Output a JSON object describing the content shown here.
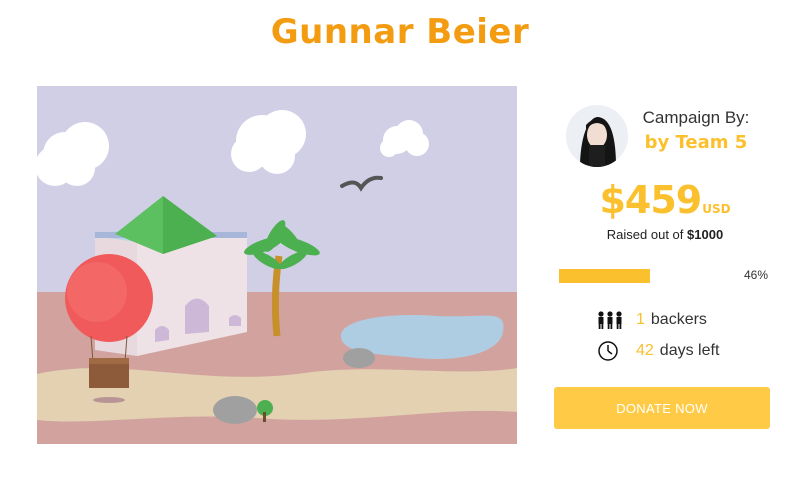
{
  "page": {
    "title": "Gunnar Beier"
  },
  "campaign": {
    "by_label": "Campaign By:",
    "team": "by Team 5",
    "amount": "$459",
    "currency": "USD",
    "raised_prefix": "Raised out of",
    "goal": "$1000",
    "progress_percent": 46,
    "progress_label": "46%",
    "backers_count": "1",
    "backers_label": "backers",
    "days_count": "42",
    "days_label": "days left",
    "donate_label": "DONATE NOW"
  },
  "icons": {
    "backers": "people-icon",
    "days": "clock-icon"
  },
  "colors": {
    "title": "#f39c12",
    "accent": "#fbc02d",
    "button": "#ffcb47"
  }
}
